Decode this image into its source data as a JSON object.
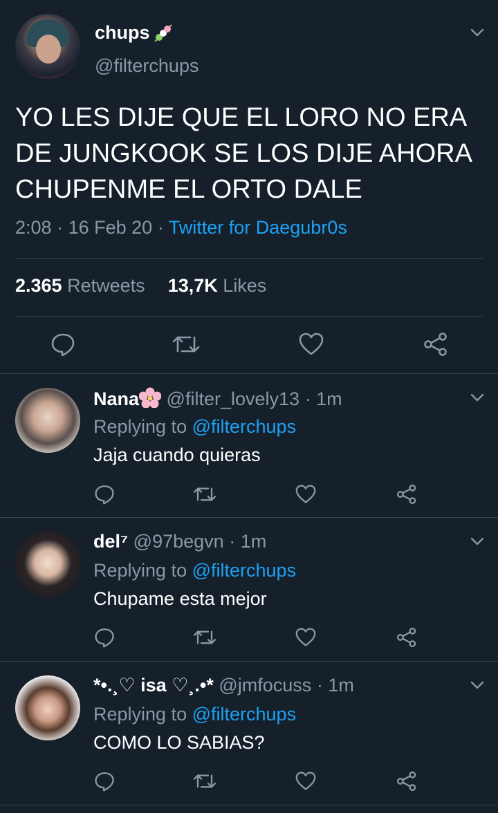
{
  "main_tweet": {
    "name": "chups",
    "name_emoji_icon": "dango-icon",
    "handle": "@filterchups",
    "text": "YO LES DIJE QUE EL LORO NO ERA DE JUNGKOOK SE LOS DIJE AHORA CHUPENME EL ORTO DALE",
    "time": "2:08",
    "date": "16 Feb 20",
    "source": "Twitter for Daegubr0s",
    "retweets_count": "2.365",
    "retweets_label": "Retweets",
    "likes_count": "13,7K",
    "likes_label": "Likes"
  },
  "separator": "·",
  "replies": [
    {
      "name": "Nana",
      "name_emoji_icon": "cherry-blossom-icon",
      "handle": "@filter_lovely13",
      "time": "1m",
      "replying_label": "Replying to",
      "replying_to": "@filterchups",
      "text": "Jaja cuando quieras"
    },
    {
      "name": "del⁷",
      "handle": "@97begvn",
      "time": "1m",
      "replying_label": "Replying to",
      "replying_to": "@filterchups",
      "text": "Chupame esta mejor"
    },
    {
      "name": "*•.¸♡ isa ♡¸.•*",
      "handle": "@jmfocuss",
      "time": "1m",
      "replying_label": "Replying to",
      "replying_to": "@filterchups",
      "text": "COMO LO SABIAS?"
    }
  ],
  "colors": {
    "background": "#15202b",
    "muted": "#8899a6",
    "link": "#1da1f2",
    "divider": "#38444d"
  }
}
